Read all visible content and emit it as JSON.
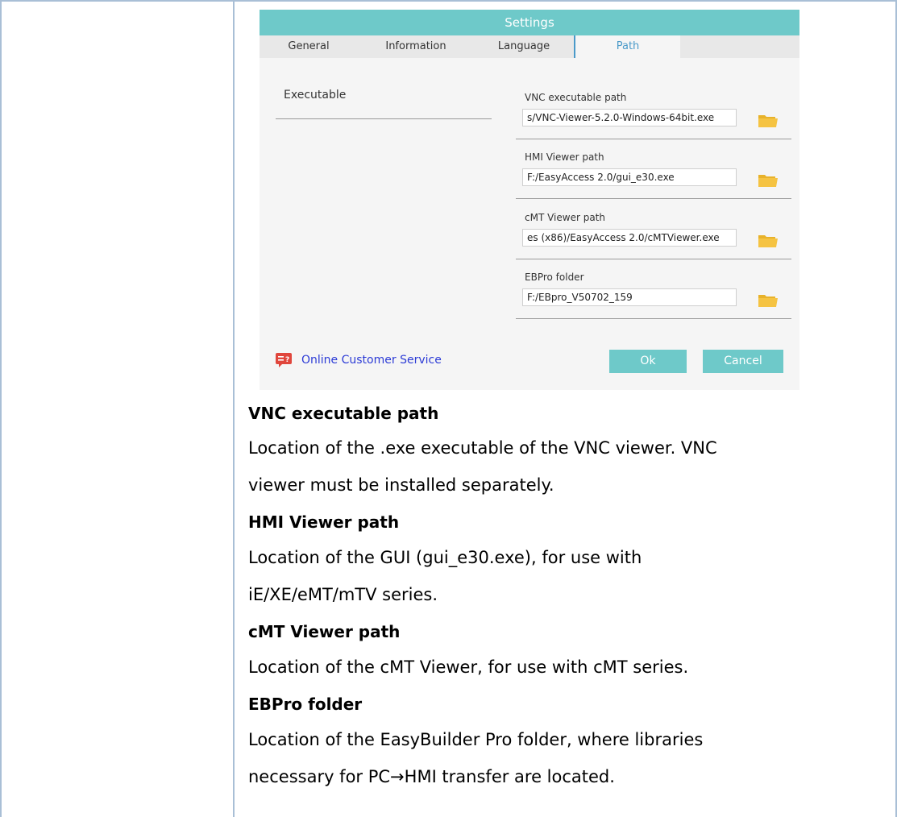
{
  "dialog": {
    "title": "Settings",
    "tabs": [
      {
        "label": "General"
      },
      {
        "label": "Information"
      },
      {
        "label": "Language"
      },
      {
        "label": "Path"
      }
    ],
    "left_section_label": "Executable",
    "paths": [
      {
        "label": "VNC executable path",
        "value": "s/VNC-Viewer-5.2.0-Windows-64bit.exe"
      },
      {
        "label": "HMI Viewer path",
        "value": "F:/EasyAccess 2.0/gui_e30.exe"
      },
      {
        "label": "cMT Viewer path",
        "value": "es (x86)/EasyAccess 2.0/cMTViewer.exe"
      },
      {
        "label": "EBPro folder",
        "value": "F:/EBpro_V50702_159"
      }
    ],
    "customer_service_label": "Online Customer Service",
    "ok_label": "Ok",
    "cancel_label": "Cancel",
    "colors": {
      "accent": "#6ec9c9",
      "tab_active": "#4a9ac9",
      "link": "#2c3bd6",
      "folder": "#f5c342"
    }
  },
  "description": {
    "vnc_heading": "VNC executable path",
    "vnc_line1": "Location of the .exe executable of the VNC viewer. VNC",
    "vnc_line2": "viewer must be installed separately.",
    "hmi_heading": "HMI Viewer path",
    "hmi_line1": "Location of the GUI (gui_e30.exe), for use with",
    "hmi_line2": "iE/XE/eMT/mTV series.",
    "cmt_heading": "cMT Viewer path",
    "cmt_line1": "Location of the cMT Viewer, for use with cMT series.",
    "ebpro_heading": "EBPro folder",
    "ebpro_line1": "Location of the EasyBuilder Pro folder, where libraries",
    "ebpro_line2": "necessary for PC→HMI transfer are located."
  }
}
